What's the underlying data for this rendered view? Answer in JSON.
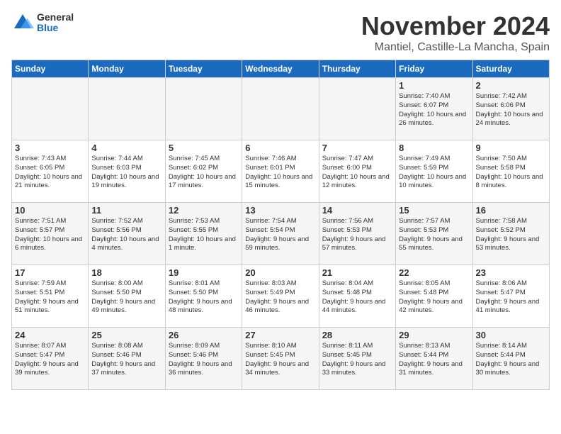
{
  "header": {
    "logo_general": "General",
    "logo_blue": "Blue",
    "month_title": "November 2024",
    "location": "Mantiel, Castille-La Mancha, Spain"
  },
  "weekdays": [
    "Sunday",
    "Monday",
    "Tuesday",
    "Wednesday",
    "Thursday",
    "Friday",
    "Saturday"
  ],
  "weeks": [
    [
      {
        "day": "",
        "info": ""
      },
      {
        "day": "",
        "info": ""
      },
      {
        "day": "",
        "info": ""
      },
      {
        "day": "",
        "info": ""
      },
      {
        "day": "",
        "info": ""
      },
      {
        "day": "1",
        "info": "Sunrise: 7:40 AM\nSunset: 6:07 PM\nDaylight: 10 hours and 26 minutes."
      },
      {
        "day": "2",
        "info": "Sunrise: 7:42 AM\nSunset: 6:06 PM\nDaylight: 10 hours and 24 minutes."
      }
    ],
    [
      {
        "day": "3",
        "info": "Sunrise: 7:43 AM\nSunset: 6:05 PM\nDaylight: 10 hours and 21 minutes."
      },
      {
        "day": "4",
        "info": "Sunrise: 7:44 AM\nSunset: 6:03 PM\nDaylight: 10 hours and 19 minutes."
      },
      {
        "day": "5",
        "info": "Sunrise: 7:45 AM\nSunset: 6:02 PM\nDaylight: 10 hours and 17 minutes."
      },
      {
        "day": "6",
        "info": "Sunrise: 7:46 AM\nSunset: 6:01 PM\nDaylight: 10 hours and 15 minutes."
      },
      {
        "day": "7",
        "info": "Sunrise: 7:47 AM\nSunset: 6:00 PM\nDaylight: 10 hours and 12 minutes."
      },
      {
        "day": "8",
        "info": "Sunrise: 7:49 AM\nSunset: 5:59 PM\nDaylight: 10 hours and 10 minutes."
      },
      {
        "day": "9",
        "info": "Sunrise: 7:50 AM\nSunset: 5:58 PM\nDaylight: 10 hours and 8 minutes."
      }
    ],
    [
      {
        "day": "10",
        "info": "Sunrise: 7:51 AM\nSunset: 5:57 PM\nDaylight: 10 hours and 6 minutes."
      },
      {
        "day": "11",
        "info": "Sunrise: 7:52 AM\nSunset: 5:56 PM\nDaylight: 10 hours and 4 minutes."
      },
      {
        "day": "12",
        "info": "Sunrise: 7:53 AM\nSunset: 5:55 PM\nDaylight: 10 hours and 1 minute."
      },
      {
        "day": "13",
        "info": "Sunrise: 7:54 AM\nSunset: 5:54 PM\nDaylight: 9 hours and 59 minutes."
      },
      {
        "day": "14",
        "info": "Sunrise: 7:56 AM\nSunset: 5:53 PM\nDaylight: 9 hours and 57 minutes."
      },
      {
        "day": "15",
        "info": "Sunrise: 7:57 AM\nSunset: 5:53 PM\nDaylight: 9 hours and 55 minutes."
      },
      {
        "day": "16",
        "info": "Sunrise: 7:58 AM\nSunset: 5:52 PM\nDaylight: 9 hours and 53 minutes."
      }
    ],
    [
      {
        "day": "17",
        "info": "Sunrise: 7:59 AM\nSunset: 5:51 PM\nDaylight: 9 hours and 51 minutes."
      },
      {
        "day": "18",
        "info": "Sunrise: 8:00 AM\nSunset: 5:50 PM\nDaylight: 9 hours and 49 minutes."
      },
      {
        "day": "19",
        "info": "Sunrise: 8:01 AM\nSunset: 5:50 PM\nDaylight: 9 hours and 48 minutes."
      },
      {
        "day": "20",
        "info": "Sunrise: 8:03 AM\nSunset: 5:49 PM\nDaylight: 9 hours and 46 minutes."
      },
      {
        "day": "21",
        "info": "Sunrise: 8:04 AM\nSunset: 5:48 PM\nDaylight: 9 hours and 44 minutes."
      },
      {
        "day": "22",
        "info": "Sunrise: 8:05 AM\nSunset: 5:48 PM\nDaylight: 9 hours and 42 minutes."
      },
      {
        "day": "23",
        "info": "Sunrise: 8:06 AM\nSunset: 5:47 PM\nDaylight: 9 hours and 41 minutes."
      }
    ],
    [
      {
        "day": "24",
        "info": "Sunrise: 8:07 AM\nSunset: 5:47 PM\nDaylight: 9 hours and 39 minutes."
      },
      {
        "day": "25",
        "info": "Sunrise: 8:08 AM\nSunset: 5:46 PM\nDaylight: 9 hours and 37 minutes."
      },
      {
        "day": "26",
        "info": "Sunrise: 8:09 AM\nSunset: 5:46 PM\nDaylight: 9 hours and 36 minutes."
      },
      {
        "day": "27",
        "info": "Sunrise: 8:10 AM\nSunset: 5:45 PM\nDaylight: 9 hours and 34 minutes."
      },
      {
        "day": "28",
        "info": "Sunrise: 8:11 AM\nSunset: 5:45 PM\nDaylight: 9 hours and 33 minutes."
      },
      {
        "day": "29",
        "info": "Sunrise: 8:13 AM\nSunset: 5:44 PM\nDaylight: 9 hours and 31 minutes."
      },
      {
        "day": "30",
        "info": "Sunrise: 8:14 AM\nSunset: 5:44 PM\nDaylight: 9 hours and 30 minutes."
      }
    ]
  ]
}
